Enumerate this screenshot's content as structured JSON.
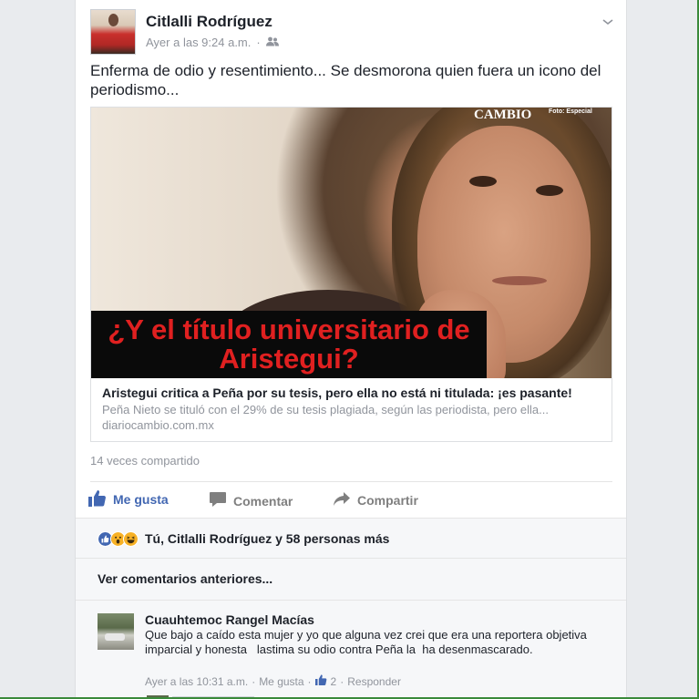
{
  "post": {
    "author": "Citlalli Rodríguez",
    "timestamp": "Ayer a las 9:24 a.m.",
    "separator": "·",
    "audience_icon": "friends-icon",
    "text": "Enferma de odio y resentimiento... Se desmorona quien fuera un icono del periodismo..."
  },
  "link": {
    "image_text": "¿Y el título universitario de Aristegui?",
    "watermark": "CAMBIO",
    "photo_credit": "Foto: Especial",
    "title": "Aristegui critica a Peña por su tesis, pero ella no está ni titulada: ¡es pasante!",
    "description": "Peña Nieto se tituló con el 29% de su tesis plagiada, según las periodista, pero ella...",
    "domain": "diariocambio.com.mx"
  },
  "shares": "14 veces compartido",
  "actions": {
    "like": "Me gusta",
    "comment": "Comentar",
    "share": "Compartir"
  },
  "reactions": {
    "icons": [
      "like-icon",
      "wow-icon",
      "haha-icon"
    ],
    "colors": {
      "like": "#4267b2",
      "wow": "#f7b125",
      "haha": "#f7b125"
    },
    "summary": "Tú, Citlalli Rodríguez y 58 personas más"
  },
  "previous_comments": "Ver comentarios anteriores...",
  "comment": {
    "author": "Cuauhtemoc Rangel Macías",
    "text": "Que bajo a caído esta mujer y yo que alguna vez crei que era una reportera objetiva imparcial y honesta   lastima su odio contra Peña la  ha desenmascarado.",
    "time": "Ayer a las 10:31 a.m.",
    "dot1": "·",
    "like": "Me gusta",
    "dot2": "·",
    "like_count": "2",
    "dot3": "·",
    "reply": "Responder"
  },
  "colors": {
    "accent": "#4267b2",
    "muted": "#90949c",
    "banner_text": "#e02020"
  }
}
